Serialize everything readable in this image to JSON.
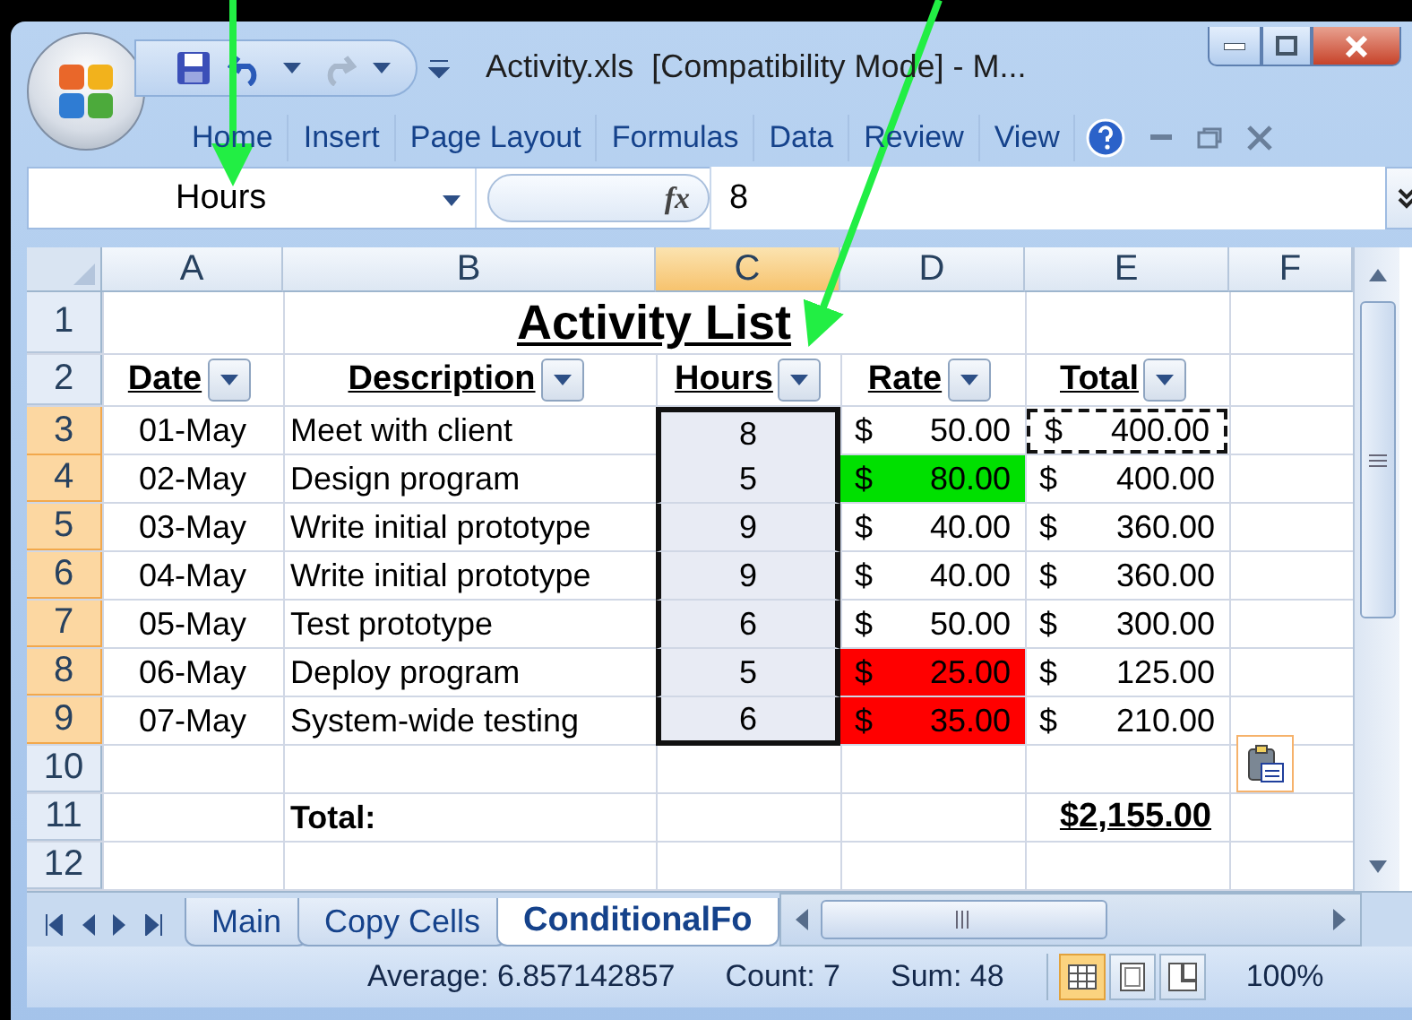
{
  "window": {
    "title": "Activity.xls  [Compatibility Mode] - M..."
  },
  "ribbon_tabs": [
    "Home",
    "Insert",
    "Page Layout",
    "Formulas",
    "Data",
    "Review",
    "View"
  ],
  "formula_bar": {
    "name_box": "Hours",
    "function_label": "fx",
    "value": "8"
  },
  "columns": [
    {
      "label": "A",
      "selected": false
    },
    {
      "label": "B",
      "selected": false
    },
    {
      "label": "C",
      "selected": true
    },
    {
      "label": "D",
      "selected": false
    },
    {
      "label": "E",
      "selected": false
    },
    {
      "label": "F",
      "selected": false
    }
  ],
  "rows": [
    {
      "label": "1",
      "selected": false,
      "cells": [
        {
          "kind": "empty"
        },
        {
          "kind": "title",
          "text": "Activity List"
        }
      ]
    },
    {
      "label": "2",
      "selected": false,
      "cells": [
        {
          "kind": "header",
          "text": "Date"
        },
        {
          "kind": "header",
          "text": "Description"
        },
        {
          "kind": "header",
          "text": "Hours"
        },
        {
          "kind": "header",
          "text": "Rate"
        },
        {
          "kind": "header",
          "text": "Total"
        },
        {
          "kind": "empty"
        }
      ]
    },
    {
      "label": "3",
      "selected": true,
      "cells": [
        {
          "kind": "date",
          "text": "01-May"
        },
        {
          "kind": "text",
          "text": "Meet with client"
        },
        {
          "kind": "number",
          "text": "8",
          "selected": true
        },
        {
          "kind": "currency",
          "symbol": "$",
          "amount": "50.00"
        },
        {
          "kind": "currency",
          "symbol": "$",
          "amount": "400.00",
          "copied": true
        },
        {
          "kind": "empty"
        }
      ]
    },
    {
      "label": "4",
      "selected": true,
      "cells": [
        {
          "kind": "date",
          "text": "02-May"
        },
        {
          "kind": "text",
          "text": "Design program"
        },
        {
          "kind": "number",
          "text": "5",
          "selected": true
        },
        {
          "kind": "currency",
          "symbol": "$",
          "amount": "80.00",
          "color": "#00e000"
        },
        {
          "kind": "currency",
          "symbol": "$",
          "amount": "400.00"
        },
        {
          "kind": "empty"
        }
      ]
    },
    {
      "label": "5",
      "selected": true,
      "cells": [
        {
          "kind": "date",
          "text": "03-May"
        },
        {
          "kind": "text",
          "text": "Write initial prototype"
        },
        {
          "kind": "number",
          "text": "9",
          "selected": true
        },
        {
          "kind": "currency",
          "symbol": "$",
          "amount": "40.00"
        },
        {
          "kind": "currency",
          "symbol": "$",
          "amount": "360.00"
        },
        {
          "kind": "empty"
        }
      ]
    },
    {
      "label": "6",
      "selected": true,
      "cells": [
        {
          "kind": "date",
          "text": "04-May"
        },
        {
          "kind": "text",
          "text": "Write initial prototype"
        },
        {
          "kind": "number",
          "text": "9",
          "selected": true
        },
        {
          "kind": "currency",
          "symbol": "$",
          "amount": "40.00"
        },
        {
          "kind": "currency",
          "symbol": "$",
          "amount": "360.00"
        },
        {
          "kind": "empty"
        }
      ]
    },
    {
      "label": "7",
      "selected": true,
      "cells": [
        {
          "kind": "date",
          "text": "05-May"
        },
        {
          "kind": "text",
          "text": "Test prototype"
        },
        {
          "kind": "number",
          "text": "6",
          "selected": true
        },
        {
          "kind": "currency",
          "symbol": "$",
          "amount": "50.00"
        },
        {
          "kind": "currency",
          "symbol": "$",
          "amount": "300.00"
        },
        {
          "kind": "empty"
        }
      ]
    },
    {
      "label": "8",
      "selected": true,
      "cells": [
        {
          "kind": "date",
          "text": "06-May"
        },
        {
          "kind": "text",
          "text": "Deploy program"
        },
        {
          "kind": "number",
          "text": "5",
          "selected": true
        },
        {
          "kind": "currency",
          "symbol": "$",
          "amount": "25.00",
          "color": "#ff0000"
        },
        {
          "kind": "currency",
          "symbol": "$",
          "amount": "125.00"
        },
        {
          "kind": "empty"
        }
      ]
    },
    {
      "label": "9",
      "selected": true,
      "cells": [
        {
          "kind": "date",
          "text": "07-May"
        },
        {
          "kind": "text",
          "text": "System-wide testing"
        },
        {
          "kind": "number",
          "text": "6",
          "selected": true
        },
        {
          "kind": "currency",
          "symbol": "$",
          "amount": "35.00",
          "color": "#ff0000"
        },
        {
          "kind": "currency",
          "symbol": "$",
          "amount": "210.00"
        },
        {
          "kind": "empty"
        }
      ]
    },
    {
      "label": "10",
      "selected": false,
      "cells": [
        {
          "kind": "empty"
        },
        {
          "kind": "empty"
        },
        {
          "kind": "empty"
        },
        {
          "kind": "empty"
        },
        {
          "kind": "empty"
        },
        {
          "kind": "paste_options"
        }
      ]
    },
    {
      "label": "11",
      "selected": false,
      "cells": [
        {
          "kind": "empty"
        },
        {
          "kind": "label",
          "text": "Total:"
        },
        {
          "kind": "empty"
        },
        {
          "kind": "empty"
        },
        {
          "kind": "total",
          "text": "$2,155.00"
        },
        {
          "kind": "empty"
        }
      ]
    },
    {
      "label": "12",
      "selected": false,
      "cells": [
        {
          "kind": "empty"
        },
        {
          "kind": "empty"
        },
        {
          "kind": "empty"
        },
        {
          "kind": "empty"
        },
        {
          "kind": "empty"
        },
        {
          "kind": "empty"
        }
      ]
    }
  ],
  "sheet_tabs": [
    {
      "label": "Main",
      "selected": false
    },
    {
      "label": "Copy Cells",
      "selected": false
    },
    {
      "label": "ConditionalFo",
      "selected": true
    }
  ],
  "status_bar": {
    "average": "Average: 6.857142857",
    "count": "Count: 7",
    "sum": "Sum: 48",
    "zoom": "100%"
  },
  "view_buttons": [
    {
      "kind": "normal",
      "selected": true
    },
    {
      "kind": "page_layout",
      "selected": false
    },
    {
      "kind": "page_break",
      "selected": false
    }
  ]
}
